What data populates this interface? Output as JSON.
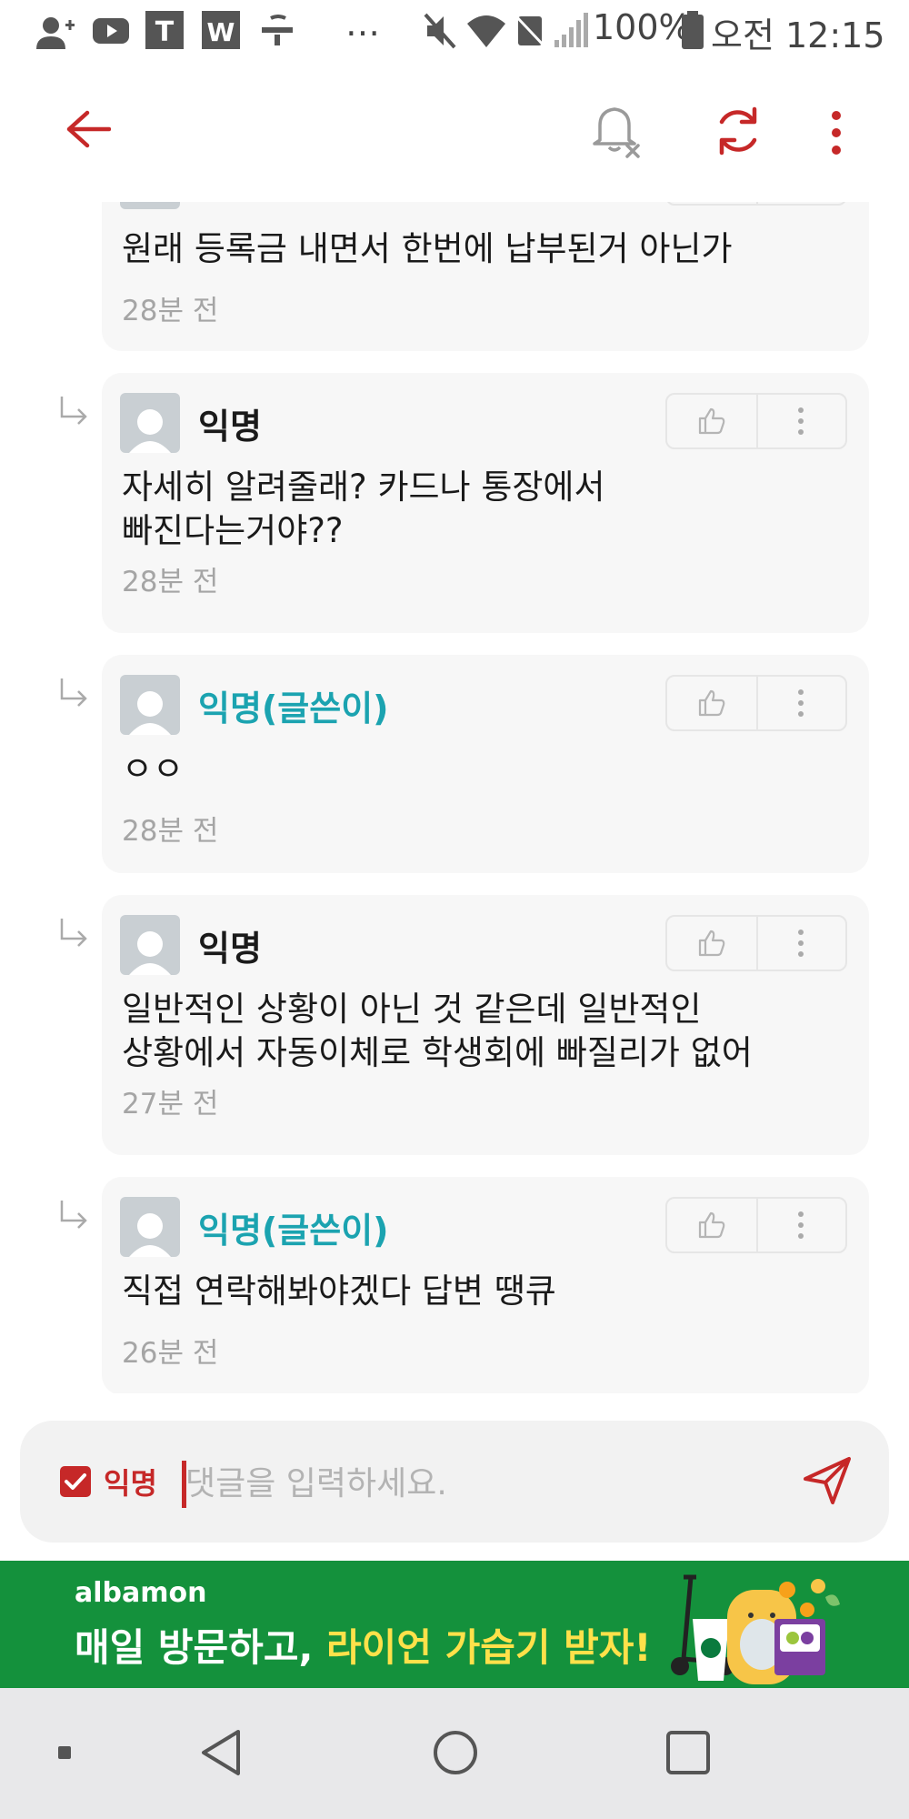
{
  "status_bar": {
    "battery": "100%",
    "time": "오전 12:15",
    "app_icons": [
      "add-contact-icon",
      "youtube-icon",
      "t-app-icon",
      "w-app-icon",
      "wifi-calling-icon",
      "more-notifications-icon"
    ],
    "system_icons": [
      "mute-icon",
      "wifi-icon",
      "nfc-off-icon",
      "signal-icon",
      "battery-icon"
    ]
  },
  "header": {
    "back_icon": "arrow-left-icon",
    "notification_icon": "bell-off-icon",
    "refresh_icon": "refresh-icon",
    "more_icon": "more-vertical-icon",
    "accent_color": "#c62828"
  },
  "comments": [
    {
      "author": "",
      "body": "원래 등록금 내면서 한번에 납부된거 아닌가",
      "time": "28분 전",
      "is_op": false,
      "partial": true
    },
    {
      "author": "익명",
      "body": "자세히 알려줄래? 카드나 통장에서\n빠진다는거야??",
      "time": "28분 전",
      "is_op": false
    },
    {
      "author": "익명(글쓴이)",
      "body": "ㅇㅇ",
      "time": "28분 전",
      "is_op": true
    },
    {
      "author": "익명",
      "body": "일반적인 상황이 아닌 것 같은데 일반적인\n상황에서 자동이체로 학생회에 빠질리가 없어",
      "time": "27분 전",
      "is_op": false
    },
    {
      "author": "익명(글쓴이)",
      "body": "직접 연락해봐야겠다 답변 땡큐",
      "time": "26분 전",
      "is_op": true
    }
  ],
  "composer": {
    "anonymous_label": "익명",
    "anonymous_checked": true,
    "placeholder": "댓글을 입력하세요.",
    "send_icon": "send-icon"
  },
  "ad_banner": {
    "brand": "albamon",
    "headline_part1": "매일 방문하고, ",
    "headline_highlight": "라이언 가습기 받자!",
    "background": "#14913c",
    "highlight_color": "#ffe14a"
  },
  "nav_bar": {
    "buttons": [
      "square-dot-icon",
      "back-triangle-icon",
      "home-circle-icon",
      "recents-square-icon"
    ]
  }
}
